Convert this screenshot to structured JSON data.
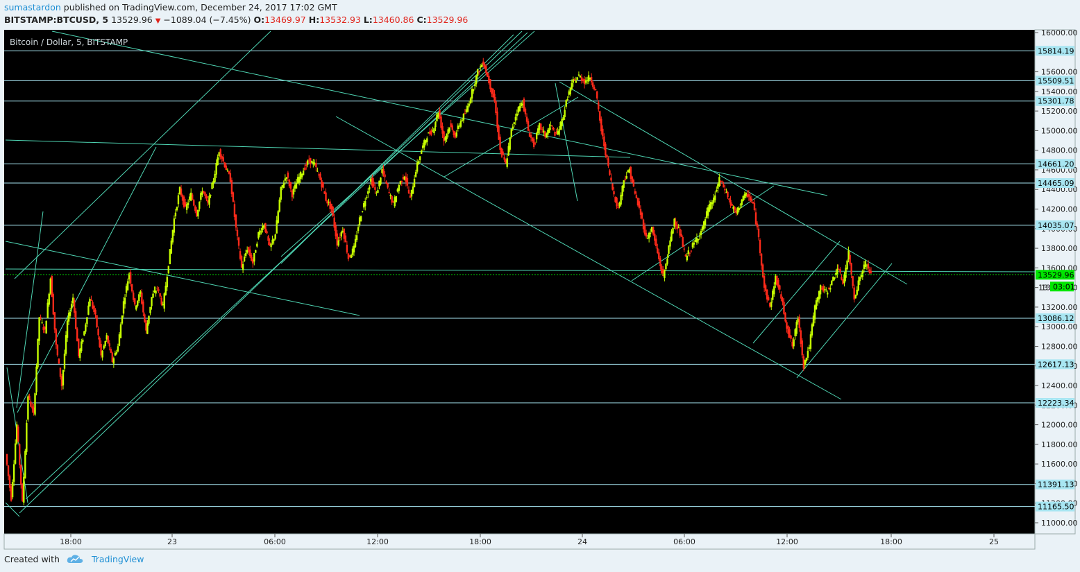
{
  "header": {
    "username": "sumastardon",
    "published_text": "published on TradingView.com, December 24, 2017 17:02 GMT",
    "symbol": "BITSTAMP:BTCUSD, 5",
    "last": "13529.96",
    "change": "−1089.04 (−7.45%)",
    "o_label": "O:",
    "o_value": "13469.97",
    "h_label": "H:",
    "h_value": "13532.93",
    "l_label": "L:",
    "l_value": "13460.86",
    "c_label": "C:",
    "c_value": "13529.96"
  },
  "footer": {
    "created_with": "Created with",
    "brand": "TradingView"
  },
  "colors": {
    "background": "#000000",
    "up_candle": "#c6ff00",
    "down_candle": "#ff2a1a",
    "trendline": "#4fd6b4",
    "level_line": "#a8e6f2",
    "level_label_bg": "#a8e6f2",
    "price_label_bg": "#00e600",
    "axis_bg": "#eaf2f7"
  },
  "chart_data": {
    "type": "candlestick",
    "title": "Bitcoin / Dollar, 5, BITSTAMP",
    "timeframe": "5",
    "exchange": "BITSTAMP",
    "y_range": [
      10920,
      16050
    ],
    "y_ticks": [
      "16000.00",
      "15600.00",
      "15400.00",
      "15200.00",
      "15000.00",
      "14800.00",
      "14600.00",
      "14400.00",
      "14200.00",
      "14000.00",
      "13800.00",
      "13600.00",
      "13400.00",
      "13200.00",
      "13000.00",
      "12800.00",
      "12600.00",
      "12400.00",
      "12200.00",
      "12000.00",
      "11800.00",
      "11600.00",
      "11400.00",
      "11200.00",
      "11000.00"
    ],
    "x_ticks": [
      "18:00",
      "23",
      "06:00",
      "12:00",
      "18:00",
      "24",
      "06:00",
      "12:00",
      "18:00",
      "25"
    ],
    "horizontal_levels": [
      15814.19,
      15509.51,
      15301.78,
      14661.2,
      14465.09,
      14035.07,
      13086.12,
      12617.13,
      12223.34,
      11391.13,
      11165.5
    ],
    "level_labels": [
      "15814.19",
      "15509.51",
      "15301.78",
      "14661.20",
      "14465.09",
      "14035.07",
      "13086.12",
      "12617.13",
      "12223.34",
      "11391.13",
      "11165.50"
    ],
    "current_price": 13529.96,
    "current_price_label": "13529.96",
    "countdown_label": "03:01",
    "partial_axis_label": "13",
    "price_path": [
      [
        0,
        11700
      ],
      [
        1,
        11250
      ],
      [
        2,
        12000
      ],
      [
        3,
        11200
      ],
      [
        4,
        12300
      ],
      [
        5,
        12100
      ],
      [
        6,
        13100
      ],
      [
        7,
        12950
      ],
      [
        8,
        13500
      ],
      [
        9,
        12800
      ],
      [
        10,
        12400
      ],
      [
        11,
        13050
      ],
      [
        12,
        13300
      ],
      [
        13,
        12700
      ],
      [
        14,
        12950
      ],
      [
        15,
        13300
      ],
      [
        16,
        13100
      ],
      [
        17,
        12700
      ],
      [
        18,
        12900
      ],
      [
        19,
        12650
      ],
      [
        20,
        12800
      ],
      [
        21,
        13250
      ],
      [
        22,
        13550
      ],
      [
        23,
        13200
      ],
      [
        24,
        13350
      ],
      [
        25,
        12950
      ],
      [
        26,
        13300
      ],
      [
        27,
        13400
      ],
      [
        28,
        13200
      ],
      [
        29,
        13650
      ],
      [
        30,
        14100
      ],
      [
        31,
        14400
      ],
      [
        32,
        14200
      ],
      [
        33,
        14350
      ],
      [
        34,
        14150
      ],
      [
        35,
        14400
      ],
      [
        36,
        14250
      ],
      [
        37,
        14500
      ],
      [
        38,
        14800
      ],
      [
        39,
        14650
      ],
      [
        40,
        14500
      ],
      [
        41,
        14000
      ],
      [
        42,
        13600
      ],
      [
        43,
        13800
      ],
      [
        44,
        13650
      ],
      [
        45,
        13950
      ],
      [
        46,
        14050
      ],
      [
        47,
        13800
      ],
      [
        48,
        13950
      ],
      [
        49,
        14400
      ],
      [
        50,
        14550
      ],
      [
        51,
        14350
      ],
      [
        52,
        14500
      ],
      [
        53,
        14600
      ],
      [
        54,
        14700
      ],
      [
        55,
        14650
      ],
      [
        56,
        14500
      ],
      [
        57,
        14300
      ],
      [
        58,
        14200
      ],
      [
        59,
        13850
      ],
      [
        60,
        14000
      ],
      [
        61,
        13700
      ],
      [
        62,
        13800
      ],
      [
        63,
        14100
      ],
      [
        64,
        14300
      ],
      [
        65,
        14500
      ],
      [
        66,
        14350
      ],
      [
        67,
        14600
      ],
      [
        68,
        14400
      ],
      [
        69,
        14250
      ],
      [
        70,
        14450
      ],
      [
        71,
        14550
      ],
      [
        72,
        14300
      ],
      [
        73,
        14600
      ],
      [
        74,
        14800
      ],
      [
        75,
        14950
      ],
      [
        76,
        15000
      ],
      [
        77,
        15200
      ],
      [
        78,
        14900
      ],
      [
        79,
        15050
      ],
      [
        80,
        14950
      ],
      [
        81,
        15100
      ],
      [
        82,
        15200
      ],
      [
        83,
        15400
      ],
      [
        84,
        15600
      ],
      [
        85,
        15700
      ],
      [
        86,
        15500
      ],
      [
        87,
        15300
      ],
      [
        88,
        14800
      ],
      [
        89,
        14650
      ],
      [
        90,
        15000
      ],
      [
        91,
        15200
      ],
      [
        92,
        15300
      ],
      [
        93,
        15000
      ],
      [
        94,
        14850
      ],
      [
        95,
        15050
      ],
      [
        96,
        14950
      ],
      [
        97,
        15050
      ],
      [
        98,
        14950
      ],
      [
        99,
        15100
      ],
      [
        100,
        15350
      ],
      [
        101,
        15500
      ],
      [
        102,
        15560
      ],
      [
        103,
        15500
      ],
      [
        104,
        15550
      ],
      [
        105,
        15400
      ],
      [
        106,
        15000
      ],
      [
        107,
        14700
      ],
      [
        108,
        14400
      ],
      [
        109,
        14200
      ],
      [
        110,
        14500
      ],
      [
        111,
        14600
      ],
      [
        112,
        14350
      ],
      [
        113,
        14150
      ],
      [
        114,
        13900
      ],
      [
        115,
        14000
      ],
      [
        116,
        13750
      ],
      [
        117,
        13500
      ],
      [
        118,
        13800
      ],
      [
        119,
        14100
      ],
      [
        120,
        13950
      ],
      [
        121,
        13700
      ],
      [
        122,
        13800
      ],
      [
        123,
        13900
      ],
      [
        124,
        14000
      ],
      [
        125,
        14200
      ],
      [
        126,
        14300
      ],
      [
        127,
        14500
      ],
      [
        128,
        14400
      ],
      [
        129,
        14250
      ],
      [
        130,
        14150
      ],
      [
        131,
        14300
      ],
      [
        132,
        14350
      ],
      [
        133,
        14250
      ],
      [
        134,
        13900
      ],
      [
        135,
        13400
      ],
      [
        136,
        13200
      ],
      [
        137,
        13500
      ],
      [
        138,
        13300
      ],
      [
        139,
        13000
      ],
      [
        140,
        12800
      ],
      [
        141,
        13100
      ],
      [
        142,
        12600
      ],
      [
        143,
        12800
      ],
      [
        144,
        13200
      ],
      [
        145,
        13400
      ],
      [
        146,
        13350
      ],
      [
        147,
        13450
      ],
      [
        148,
        13600
      ],
      [
        149,
        13450
      ],
      [
        150,
        13750
      ],
      [
        151,
        13300
      ],
      [
        152,
        13500
      ],
      [
        153,
        13650
      ],
      [
        154,
        13529.96
      ]
    ],
    "candle_count": 155
  }
}
